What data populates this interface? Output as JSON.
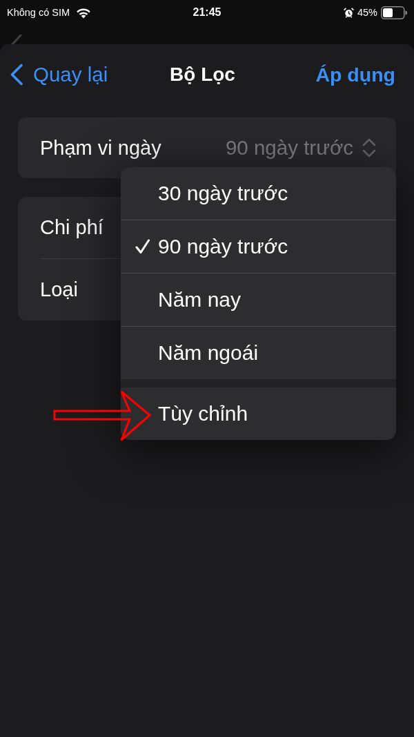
{
  "status_bar": {
    "carrier": "Không có SIM",
    "time": "21:45",
    "battery": "45%"
  },
  "sheet": {
    "nav": {
      "back": "Quay lại",
      "title": "Bộ Lọc",
      "action": "Áp dụng"
    },
    "groups": [
      {
        "rows": [
          {
            "label": "Phạm vi ngày",
            "value": "90 ngày trước"
          }
        ]
      },
      {
        "rows": [
          {
            "label": "Chi phí"
          },
          {
            "label": "Loại"
          }
        ]
      }
    ],
    "menu": {
      "sections": [
        {
          "items": [
            {
              "label": "30 ngày trước",
              "selected": false
            },
            {
              "label": "90 ngày trước",
              "selected": true
            },
            {
              "label": "Năm nay",
              "selected": false
            },
            {
              "label": "Năm ngoái",
              "selected": false
            }
          ]
        },
        {
          "items": [
            {
              "label": "Tùy chỉnh",
              "selected": false
            }
          ]
        }
      ]
    }
  }
}
